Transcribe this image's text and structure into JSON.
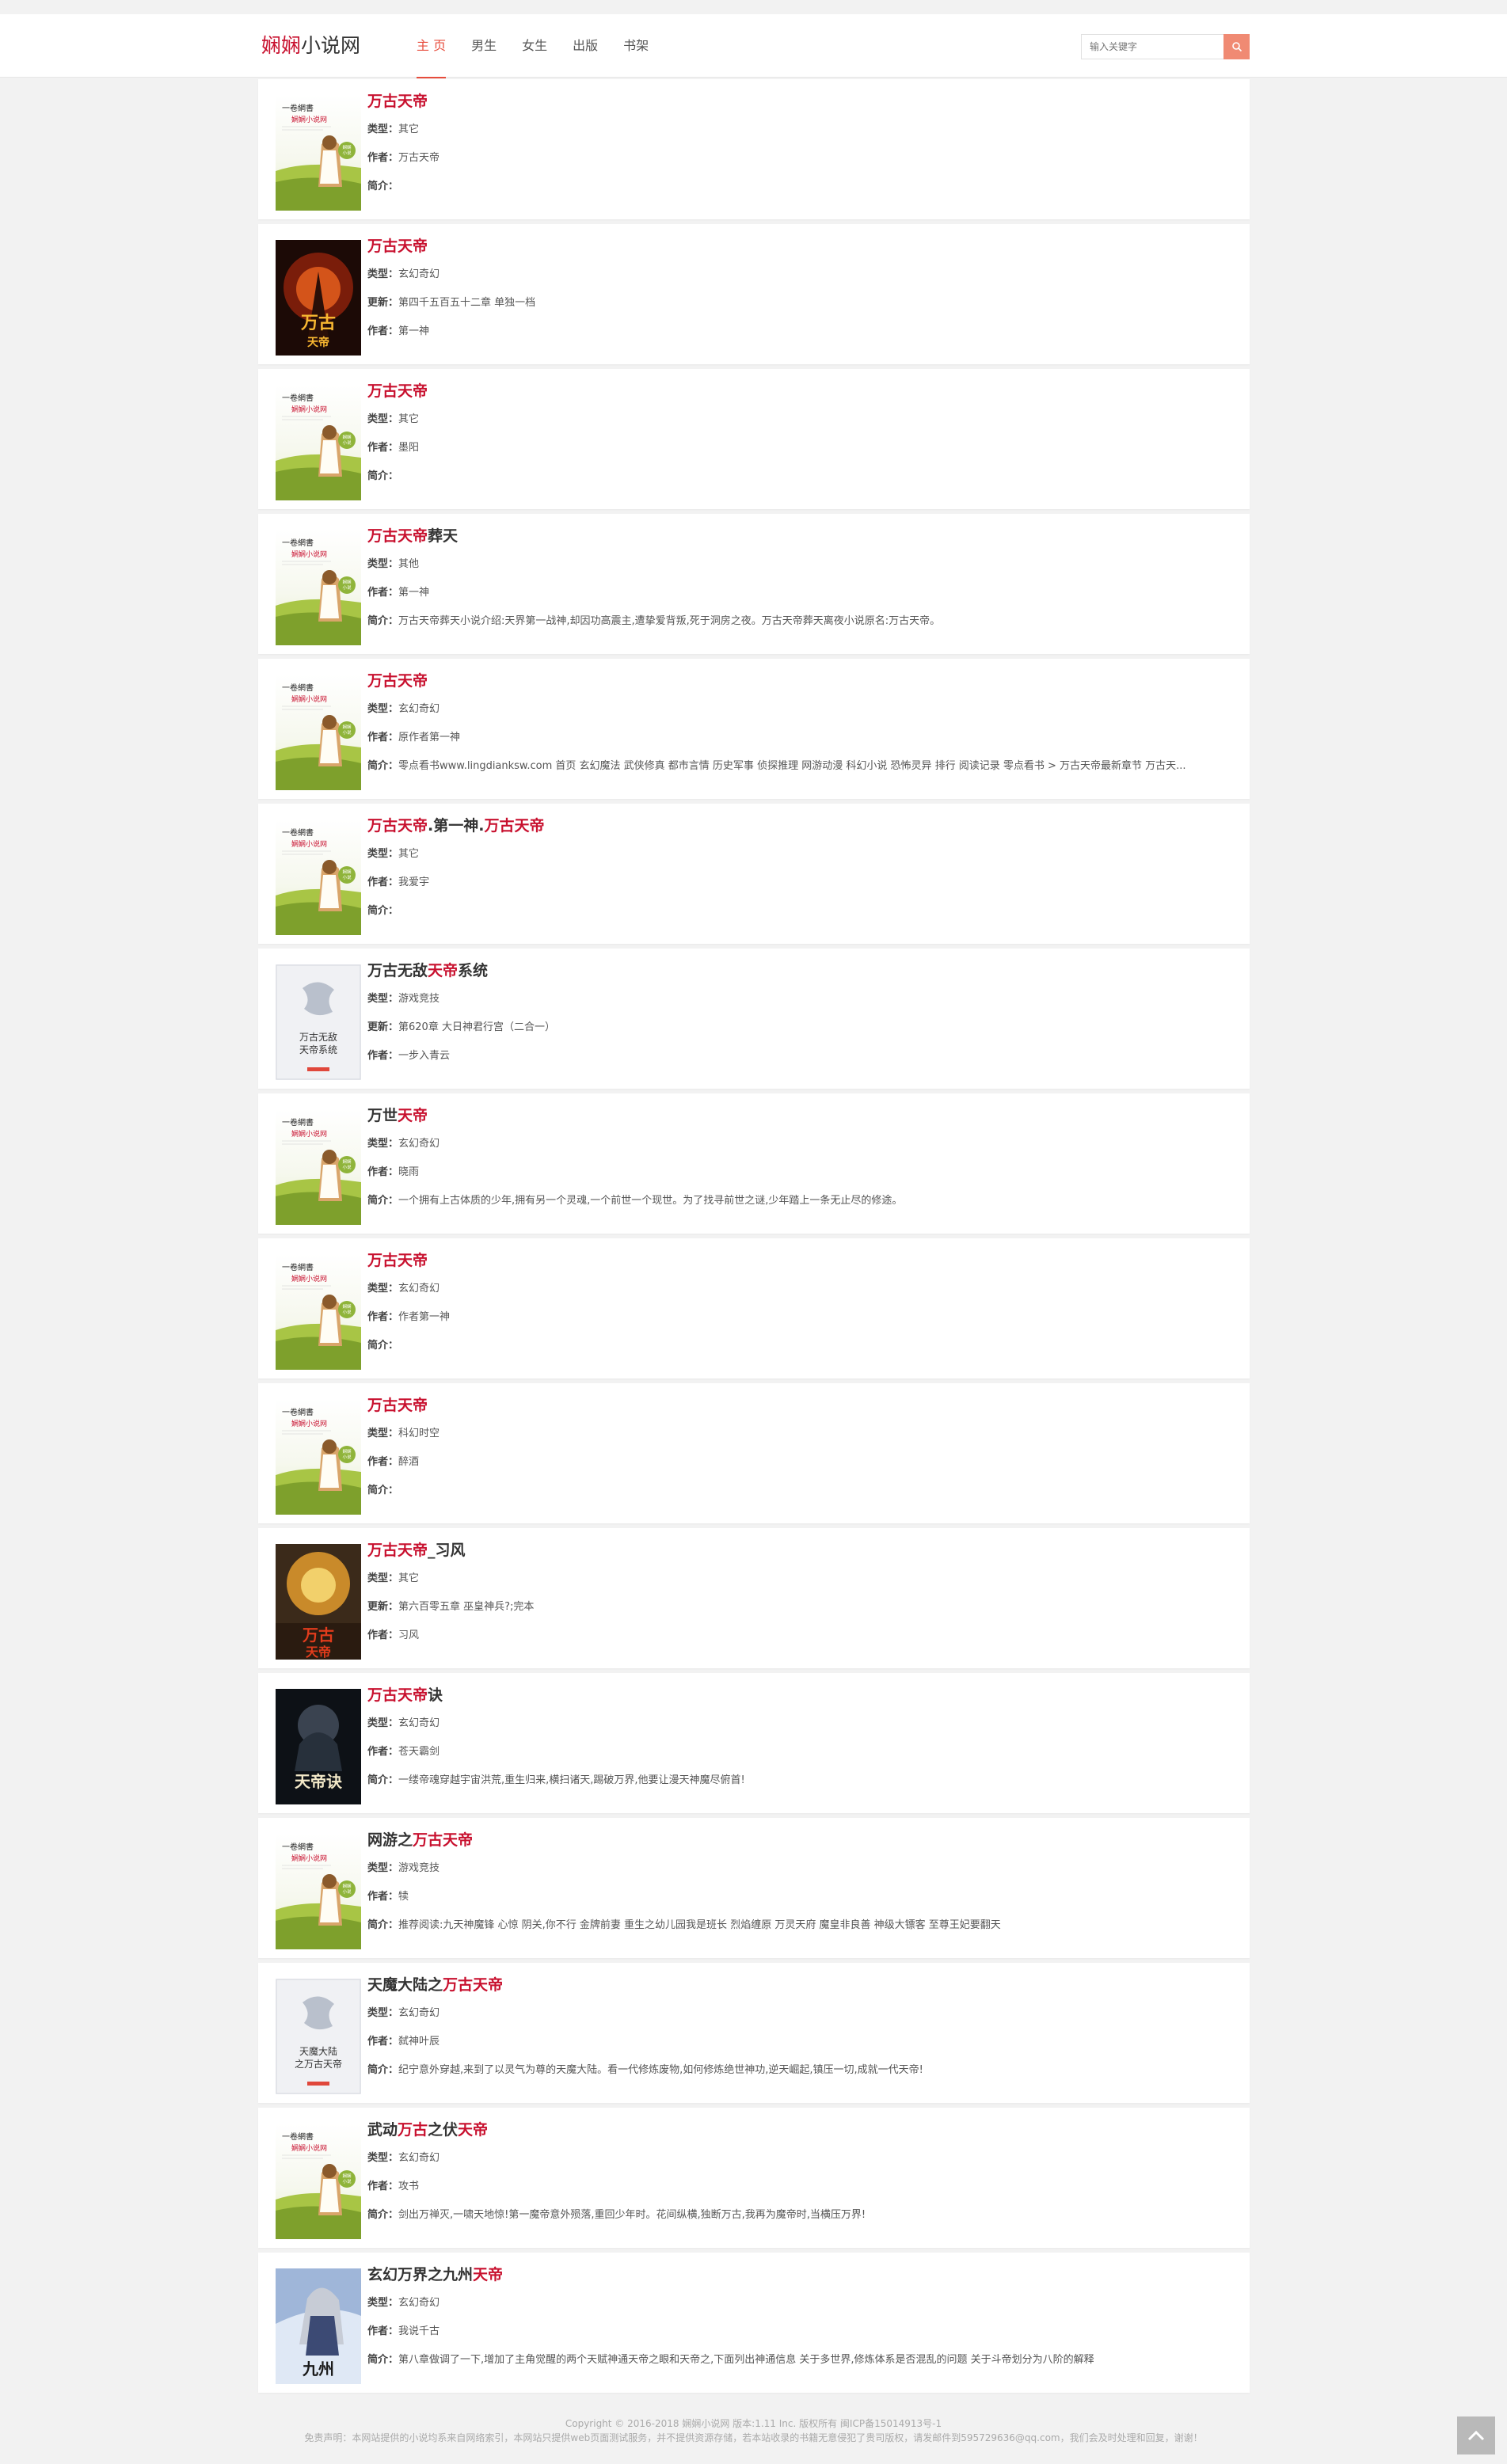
{
  "header": {
    "logo_accent": "娴娴",
    "logo_rest": "小说网",
    "nav": [
      {
        "label": "主 页",
        "active": true
      },
      {
        "label": "男生",
        "active": false
      },
      {
        "label": "女生",
        "active": false
      },
      {
        "label": "出版",
        "active": false
      },
      {
        "label": "书架",
        "active": false
      }
    ],
    "search_placeholder": "输入关键字",
    "search_icon": "search-icon"
  },
  "books": [
    {
      "title": [
        {
          "text": "万古天帝",
          "hl": true
        }
      ],
      "cover": "default",
      "rows": [
        {
          "label": "类型：",
          "value": "其它"
        },
        {
          "label": "作者：",
          "value": "万古天帝"
        },
        {
          "label": "简介：",
          "value": ""
        }
      ]
    },
    {
      "title": [
        {
          "text": "万古天帝",
          "hl": true
        }
      ],
      "cover": "fire",
      "rows": [
        {
          "label": "类型：",
          "value": "玄幻奇幻"
        },
        {
          "label": "更新：",
          "value": "第四千五百五十二章 单独一档"
        },
        {
          "label": "作者：",
          "value": "第一神"
        }
      ]
    },
    {
      "title": [
        {
          "text": "万古天帝",
          "hl": true
        }
      ],
      "cover": "default",
      "rows": [
        {
          "label": "类型：",
          "value": "其它"
        },
        {
          "label": "作者：",
          "value": "墨阳"
        },
        {
          "label": "简介：",
          "value": ""
        }
      ]
    },
    {
      "title": [
        {
          "text": "万古天帝",
          "hl": true
        },
        {
          "text": "葬天",
          "hl": false
        }
      ],
      "cover": "default",
      "rows": [
        {
          "label": "类型：",
          "value": "其他"
        },
        {
          "label": "作者：",
          "value": "第一神"
        },
        {
          "label": "简介：",
          "value": "万古天帝葬天小说介绍:天界第一战神,却因功高震主,遭挚爱背叛,死于洞房之夜。万古天帝葬天离夜小说原名:万古天帝。"
        }
      ]
    },
    {
      "title": [
        {
          "text": "万古天帝",
          "hl": true
        }
      ],
      "cover": "default",
      "rows": [
        {
          "label": "类型：",
          "value": "玄幻奇幻"
        },
        {
          "label": "作者：",
          "value": "原作者第一神"
        },
        {
          "label": "简介：",
          "value": "零点看书www.lingdianksw.com 首页 玄幻魔法 武侠修真 都市言情 历史军事 侦探推理 网游动漫 科幻小说 恐怖灵异 排行 阅读记录 零点看书 > 万古天帝最新章节 万古天..."
        }
      ]
    },
    {
      "title": [
        {
          "text": "万古天帝",
          "hl": true
        },
        {
          "text": ".第一神.",
          "hl": false
        },
        {
          "text": "万古天帝",
          "hl": true
        }
      ],
      "cover": "default",
      "rows": [
        {
          "label": "类型：",
          "value": "其它"
        },
        {
          "label": "作者：",
          "value": "我爱宇"
        },
        {
          "label": "简介：",
          "value": ""
        }
      ]
    },
    {
      "title": [
        {
          "text": "万古无敌",
          "hl": false
        },
        {
          "text": "天帝",
          "hl": true
        },
        {
          "text": "系统",
          "hl": false
        }
      ],
      "cover": "gray",
      "cover_text": "万古无敌天帝系统",
      "rows": [
        {
          "label": "类型：",
          "value": "游戏竞技"
        },
        {
          "label": "更新：",
          "value": "第620章 大日神君行宫（二合一）"
        },
        {
          "label": "作者：",
          "value": "一步入青云"
        }
      ]
    },
    {
      "title": [
        {
          "text": "万世",
          "hl": false
        },
        {
          "text": "天帝",
          "hl": true
        }
      ],
      "cover": "default",
      "rows": [
        {
          "label": "类型：",
          "value": "玄幻奇幻"
        },
        {
          "label": "作者：",
          "value": "晓雨"
        },
        {
          "label": "简介：",
          "value": "一个拥有上古体质的少年,拥有另一个灵魂,一个前世一个现世。为了找寻前世之谜,少年踏上一条无止尽的修途。"
        }
      ]
    },
    {
      "title": [
        {
          "text": "万古天帝",
          "hl": true
        }
      ],
      "cover": "default",
      "rows": [
        {
          "label": "类型：",
          "value": "玄幻奇幻"
        },
        {
          "label": "作者：",
          "value": "作者第一神"
        },
        {
          "label": "简介：",
          "value": ""
        }
      ]
    },
    {
      "title": [
        {
          "text": "万古天帝",
          "hl": true
        }
      ],
      "cover": "default",
      "rows": [
        {
          "label": "类型：",
          "value": "科幻时空"
        },
        {
          "label": "作者：",
          "value": "醉酒"
        },
        {
          "label": "简介：",
          "value": ""
        }
      ]
    },
    {
      "title": [
        {
          "text": "万古天帝",
          "hl": true
        },
        {
          "text": "_习风",
          "hl": false
        }
      ],
      "cover": "golden",
      "rows": [
        {
          "label": "类型：",
          "value": "其它"
        },
        {
          "label": "更新：",
          "value": "第六百零五章 巫皇神兵?;完本"
        },
        {
          "label": "作者：",
          "value": "习风"
        }
      ]
    },
    {
      "title": [
        {
          "text": "万古天帝",
          "hl": true
        },
        {
          "text": "诀",
          "hl": false
        }
      ],
      "cover": "dark",
      "rows": [
        {
          "label": "类型：",
          "value": "玄幻奇幻"
        },
        {
          "label": "作者：",
          "value": "苍天霸剑"
        },
        {
          "label": "简介：",
          "value": "一缕帝魂穿越宇宙洪荒,重生归来,横扫诸天,踢破万界,他要让漫天神魔尽俯首!"
        }
      ]
    },
    {
      "title": [
        {
          "text": "网游之",
          "hl": false
        },
        {
          "text": "万古天帝",
          "hl": true
        }
      ],
      "cover": "default",
      "rows": [
        {
          "label": "类型：",
          "value": "游戏竞技"
        },
        {
          "label": "作者：",
          "value": "犊"
        },
        {
          "label": "简介：",
          "value": "推荐阅读:九天神魔锋 心惊 阴关,你不行 金牌前妻 重生之幼儿园我是班长 烈焰缠原 万灵天府 魔皇非良善 神级大镖客 至尊王妃要翻天"
        }
      ]
    },
    {
      "title": [
        {
          "text": "天魔大陆之",
          "hl": false
        },
        {
          "text": "万古天帝",
          "hl": true
        }
      ],
      "cover": "gray",
      "cover_text": "天魔大陆之万古天帝",
      "rows": [
        {
          "label": "类型：",
          "value": "玄幻奇幻"
        },
        {
          "label": "作者：",
          "value": "弑神叶辰"
        },
        {
          "label": "简介：",
          "value": "纪宁意外穿越,来到了以灵气为尊的天魔大陆。看一代修炼废物,如何修炼绝世神功,逆天崛起,镇压一切,成就一代天帝!"
        }
      ]
    },
    {
      "title": [
        {
          "text": "武动",
          "hl": false
        },
        {
          "text": "万古",
          "hl": true
        },
        {
          "text": "之伏",
          "hl": false
        },
        {
          "text": "天帝",
          "hl": true
        }
      ],
      "cover": "default",
      "rows": [
        {
          "label": "类型：",
          "value": "玄幻奇幻"
        },
        {
          "label": "作者：",
          "value": "攻书"
        },
        {
          "label": "简介：",
          "value": "剑出万禅灭,一啸天地惊!第一魔帝意外殒落,重回少年时。花间纵横,独断万古,我再为魔帝时,当横压万界!"
        }
      ]
    },
    {
      "title": [
        {
          "text": "玄幻万界之九州",
          "hl": false
        },
        {
          "text": "天帝",
          "hl": true
        }
      ],
      "cover": "anime",
      "rows": [
        {
          "label": "类型：",
          "value": "玄幻奇幻"
        },
        {
          "label": "作者：",
          "value": "我说千古"
        },
        {
          "label": "简介：",
          "value": "第八章做调了一下,增加了主角觉醒的两个天赋神通天帝之眼和天帝之,下面列出神通信息 关于多世界,修炼体系是否混乱的问题 关于斗帝划分为八阶的解释"
        }
      ]
    }
  ],
  "cover_art": {
    "site_tag": "一卷網書",
    "site_name": "娴娴小说网",
    "badge": "娴娴小说",
    "fire_text": "万古天帝",
    "golden_text": "万古天帝",
    "dark_text": "天帝诀"
  },
  "footer": {
    "line1": "Copyright © 2016-2018 娴娴小说网 版本:1.11 Inc. 版权所有 闽ICP备15014913号-1",
    "line2": "免责声明：本网站提供的小说均系来自网络索引，本网站只提供web页面测试服务，并不提供资源存储，若本站收录的书籍无意侵犯了贵司版权，请发邮件到595729636@qq.com，我们会及时处理和回复，谢谢！"
  },
  "colors": {
    "accent": "#c8102e",
    "nav_active": "#e74c3c",
    "search_btn": "#f08a73"
  }
}
